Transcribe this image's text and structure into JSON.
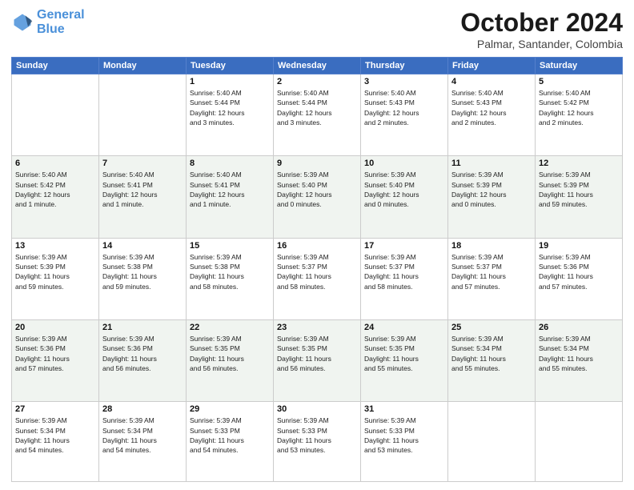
{
  "header": {
    "logo_line1": "General",
    "logo_line2": "Blue",
    "month": "October 2024",
    "location": "Palmar, Santander, Colombia"
  },
  "weekdays": [
    "Sunday",
    "Monday",
    "Tuesday",
    "Wednesday",
    "Thursday",
    "Friday",
    "Saturday"
  ],
  "weeks": [
    [
      {
        "day": "",
        "info": ""
      },
      {
        "day": "",
        "info": ""
      },
      {
        "day": "1",
        "info": "Sunrise: 5:40 AM\nSunset: 5:44 PM\nDaylight: 12 hours\nand 3 minutes."
      },
      {
        "day": "2",
        "info": "Sunrise: 5:40 AM\nSunset: 5:44 PM\nDaylight: 12 hours\nand 3 minutes."
      },
      {
        "day": "3",
        "info": "Sunrise: 5:40 AM\nSunset: 5:43 PM\nDaylight: 12 hours\nand 2 minutes."
      },
      {
        "day": "4",
        "info": "Sunrise: 5:40 AM\nSunset: 5:43 PM\nDaylight: 12 hours\nand 2 minutes."
      },
      {
        "day": "5",
        "info": "Sunrise: 5:40 AM\nSunset: 5:42 PM\nDaylight: 12 hours\nand 2 minutes."
      }
    ],
    [
      {
        "day": "6",
        "info": "Sunrise: 5:40 AM\nSunset: 5:42 PM\nDaylight: 12 hours\nand 1 minute."
      },
      {
        "day": "7",
        "info": "Sunrise: 5:40 AM\nSunset: 5:41 PM\nDaylight: 12 hours\nand 1 minute."
      },
      {
        "day": "8",
        "info": "Sunrise: 5:40 AM\nSunset: 5:41 PM\nDaylight: 12 hours\nand 1 minute."
      },
      {
        "day": "9",
        "info": "Sunrise: 5:39 AM\nSunset: 5:40 PM\nDaylight: 12 hours\nand 0 minutes."
      },
      {
        "day": "10",
        "info": "Sunrise: 5:39 AM\nSunset: 5:40 PM\nDaylight: 12 hours\nand 0 minutes."
      },
      {
        "day": "11",
        "info": "Sunrise: 5:39 AM\nSunset: 5:39 PM\nDaylight: 12 hours\nand 0 minutes."
      },
      {
        "day": "12",
        "info": "Sunrise: 5:39 AM\nSunset: 5:39 PM\nDaylight: 11 hours\nand 59 minutes."
      }
    ],
    [
      {
        "day": "13",
        "info": "Sunrise: 5:39 AM\nSunset: 5:39 PM\nDaylight: 11 hours\nand 59 minutes."
      },
      {
        "day": "14",
        "info": "Sunrise: 5:39 AM\nSunset: 5:38 PM\nDaylight: 11 hours\nand 59 minutes."
      },
      {
        "day": "15",
        "info": "Sunrise: 5:39 AM\nSunset: 5:38 PM\nDaylight: 11 hours\nand 58 minutes."
      },
      {
        "day": "16",
        "info": "Sunrise: 5:39 AM\nSunset: 5:37 PM\nDaylight: 11 hours\nand 58 minutes."
      },
      {
        "day": "17",
        "info": "Sunrise: 5:39 AM\nSunset: 5:37 PM\nDaylight: 11 hours\nand 58 minutes."
      },
      {
        "day": "18",
        "info": "Sunrise: 5:39 AM\nSunset: 5:37 PM\nDaylight: 11 hours\nand 57 minutes."
      },
      {
        "day": "19",
        "info": "Sunrise: 5:39 AM\nSunset: 5:36 PM\nDaylight: 11 hours\nand 57 minutes."
      }
    ],
    [
      {
        "day": "20",
        "info": "Sunrise: 5:39 AM\nSunset: 5:36 PM\nDaylight: 11 hours\nand 57 minutes."
      },
      {
        "day": "21",
        "info": "Sunrise: 5:39 AM\nSunset: 5:36 PM\nDaylight: 11 hours\nand 56 minutes."
      },
      {
        "day": "22",
        "info": "Sunrise: 5:39 AM\nSunset: 5:35 PM\nDaylight: 11 hours\nand 56 minutes."
      },
      {
        "day": "23",
        "info": "Sunrise: 5:39 AM\nSunset: 5:35 PM\nDaylight: 11 hours\nand 56 minutes."
      },
      {
        "day": "24",
        "info": "Sunrise: 5:39 AM\nSunset: 5:35 PM\nDaylight: 11 hours\nand 55 minutes."
      },
      {
        "day": "25",
        "info": "Sunrise: 5:39 AM\nSunset: 5:34 PM\nDaylight: 11 hours\nand 55 minutes."
      },
      {
        "day": "26",
        "info": "Sunrise: 5:39 AM\nSunset: 5:34 PM\nDaylight: 11 hours\nand 55 minutes."
      }
    ],
    [
      {
        "day": "27",
        "info": "Sunrise: 5:39 AM\nSunset: 5:34 PM\nDaylight: 11 hours\nand 54 minutes."
      },
      {
        "day": "28",
        "info": "Sunrise: 5:39 AM\nSunset: 5:34 PM\nDaylight: 11 hours\nand 54 minutes."
      },
      {
        "day": "29",
        "info": "Sunrise: 5:39 AM\nSunset: 5:33 PM\nDaylight: 11 hours\nand 54 minutes."
      },
      {
        "day": "30",
        "info": "Sunrise: 5:39 AM\nSunset: 5:33 PM\nDaylight: 11 hours\nand 53 minutes."
      },
      {
        "day": "31",
        "info": "Sunrise: 5:39 AM\nSunset: 5:33 PM\nDaylight: 11 hours\nand 53 minutes."
      },
      {
        "day": "",
        "info": ""
      },
      {
        "day": "",
        "info": ""
      }
    ]
  ]
}
